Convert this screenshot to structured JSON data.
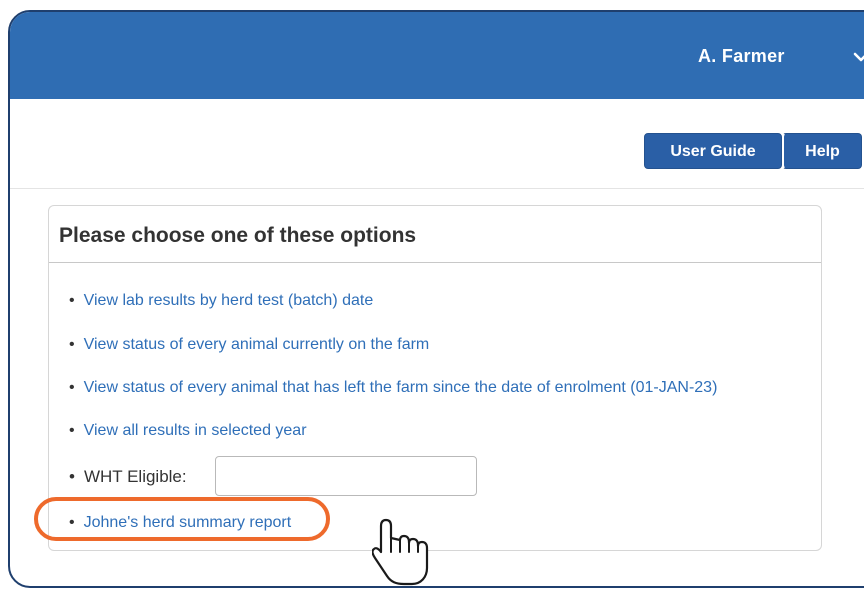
{
  "header": {
    "user_name": "A. Farmer"
  },
  "toolbar": {
    "user_guide_label": "User Guide",
    "help_label": "Help"
  },
  "panel": {
    "title": "Please choose one of these options",
    "options": [
      "View lab results by herd test (batch) date",
      "View status of every animal currently on the farm",
      "View status of every animal that has left the farm since the date of enrolment (01-JAN-23)",
      "View all results in selected year"
    ],
    "wht_label": "WHT Eligible:",
    "wht_value": "",
    "summary_link": "Johne's herd summary report"
  },
  "colors": {
    "header_bg": "#2f6db3",
    "button_bg": "#2a5fa6",
    "link": "#2f6fb8",
    "highlight": "#ee6a2c"
  },
  "icons": {
    "user_menu": "chevron-down-icon",
    "pointer": "hand-pointer-icon"
  }
}
